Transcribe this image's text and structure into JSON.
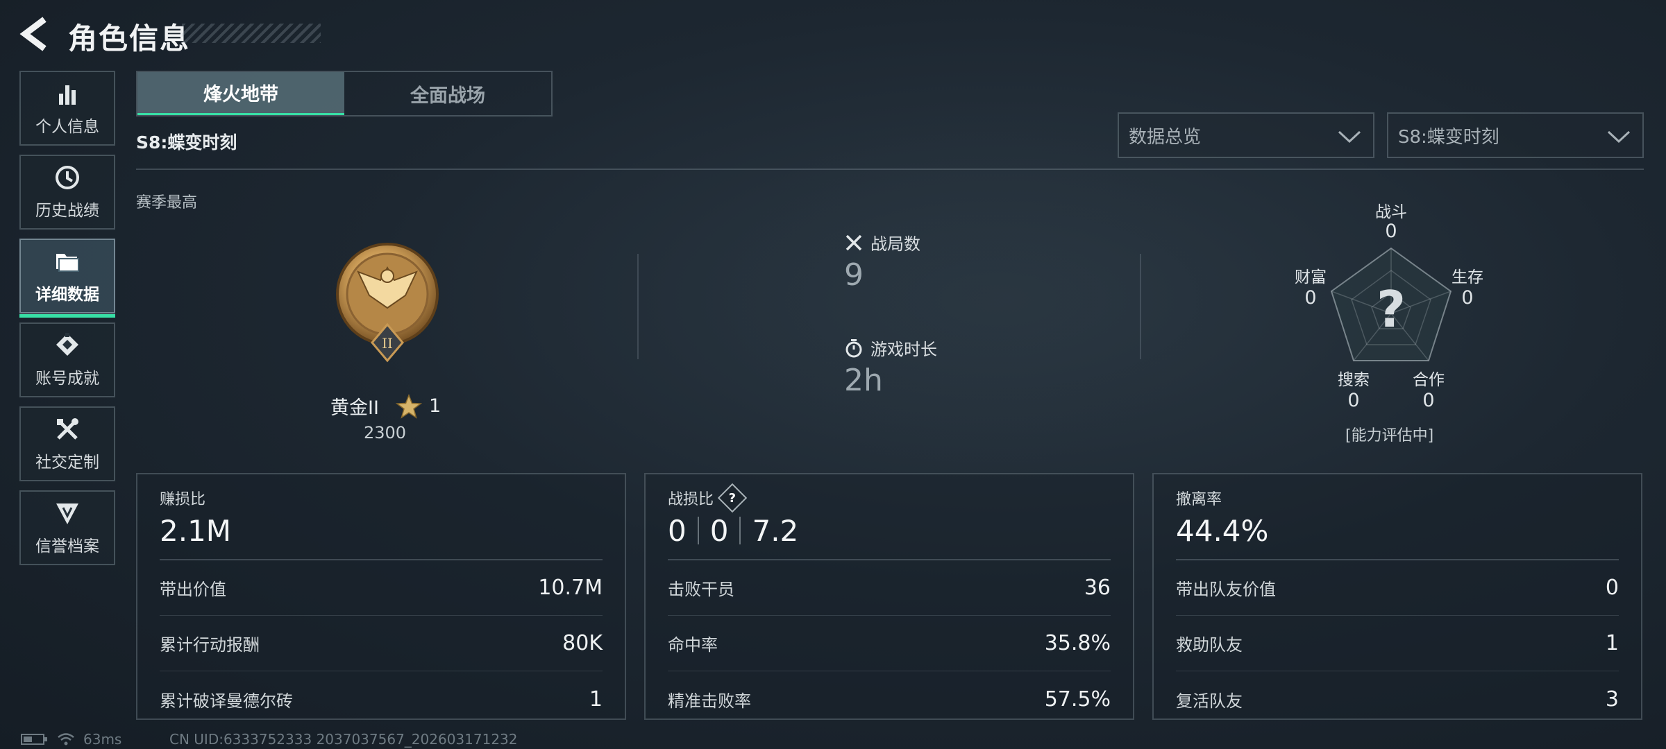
{
  "header": {
    "title": "角色信息"
  },
  "sidebar": {
    "items": [
      {
        "label": "个人信息",
        "icon": "bar-chart-icon"
      },
      {
        "label": "历史战绩",
        "icon": "clock-icon"
      },
      {
        "label": "详细数据",
        "icon": "folder-icon",
        "active": true
      },
      {
        "label": "账号成就",
        "icon": "achievement-icon"
      },
      {
        "label": "社交定制",
        "icon": "tools-icon"
      },
      {
        "label": "信誉档案",
        "icon": "shield-icon"
      }
    ]
  },
  "tabs": [
    {
      "label": "烽火地带",
      "active": true
    },
    {
      "label": "全面战场",
      "active": false
    }
  ],
  "season": {
    "label": "S8:蝶变时刻"
  },
  "dropdowns": {
    "data_type": "数据总览",
    "season": "S8:蝶变时刻"
  },
  "rank": {
    "section_label": "赛季最高",
    "name": "黄金II",
    "stars": "1",
    "score": "2300",
    "medal_numeral": "II"
  },
  "match": {
    "games_label": "战局数",
    "games_value": "9",
    "time_label": "游戏时长",
    "time_value": "2h"
  },
  "radar": {
    "note": "[能力评估中]",
    "center_symbol": "?",
    "axes": [
      {
        "label": "战斗",
        "value": "0"
      },
      {
        "label": "生存",
        "value": "0"
      },
      {
        "label": "合作",
        "value": "0"
      },
      {
        "label": "搜索",
        "value": "0"
      },
      {
        "label": "财富",
        "value": "0"
      }
    ]
  },
  "cards": {
    "profit": {
      "label": "赚损比",
      "value": "2.1M",
      "rows": [
        {
          "label": "带出价值",
          "value": "10.7M"
        },
        {
          "label": "累计行动报酬",
          "value": "80K"
        },
        {
          "label": "累计破译曼德尔砖",
          "value": "1"
        }
      ]
    },
    "kd": {
      "label": "战损比",
      "help": "?",
      "values": [
        "0",
        "0",
        "7.2"
      ],
      "rows": [
        {
          "label": "击败干员",
          "value": "36"
        },
        {
          "label": "命中率",
          "value": "35.8%"
        },
        {
          "label": "精准击败率",
          "value": "57.5%"
        }
      ]
    },
    "extract": {
      "label": "撤离率",
      "value": "44.4%",
      "rows": [
        {
          "label": "带出队友价值",
          "value": "0"
        },
        {
          "label": "救助队友",
          "value": "1"
        },
        {
          "label": "复活队友",
          "value": "3"
        }
      ]
    }
  },
  "footer": {
    "ping": "63ms",
    "uid": "CN UID:6333752333 2037037567_202603171232"
  },
  "colors": {
    "accent": "#38e0a6",
    "background": "#1d2731"
  }
}
